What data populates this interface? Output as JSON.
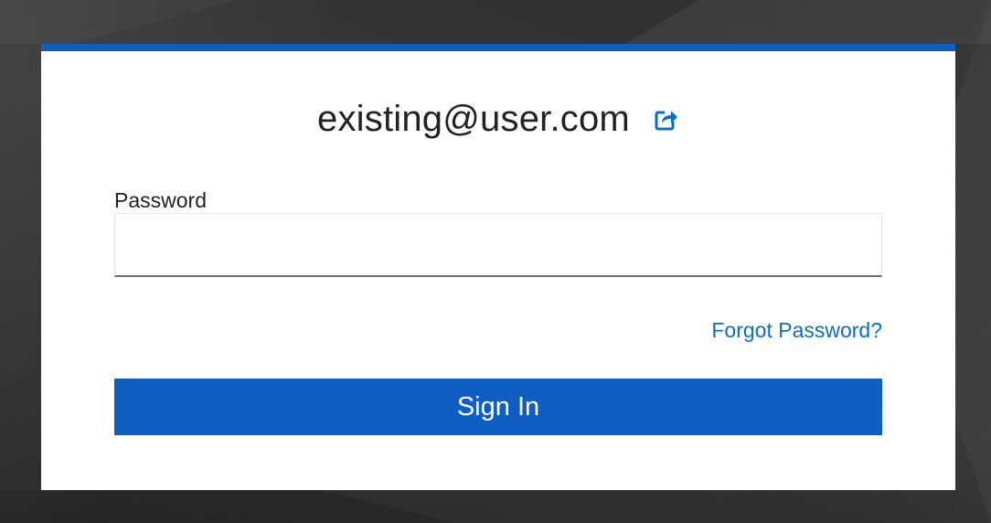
{
  "login": {
    "identity": "existing@user.com",
    "change_user_icon": "share-arrow-icon",
    "password_label": "Password",
    "password_value": "",
    "forgot_password_link": "Forgot Password?",
    "sign_in_button": "Sign In"
  },
  "colors": {
    "accent": "#0e5fc1",
    "link": "#0b6fc0",
    "background": "#303030",
    "card": "#ffffff",
    "text": "#222222"
  }
}
